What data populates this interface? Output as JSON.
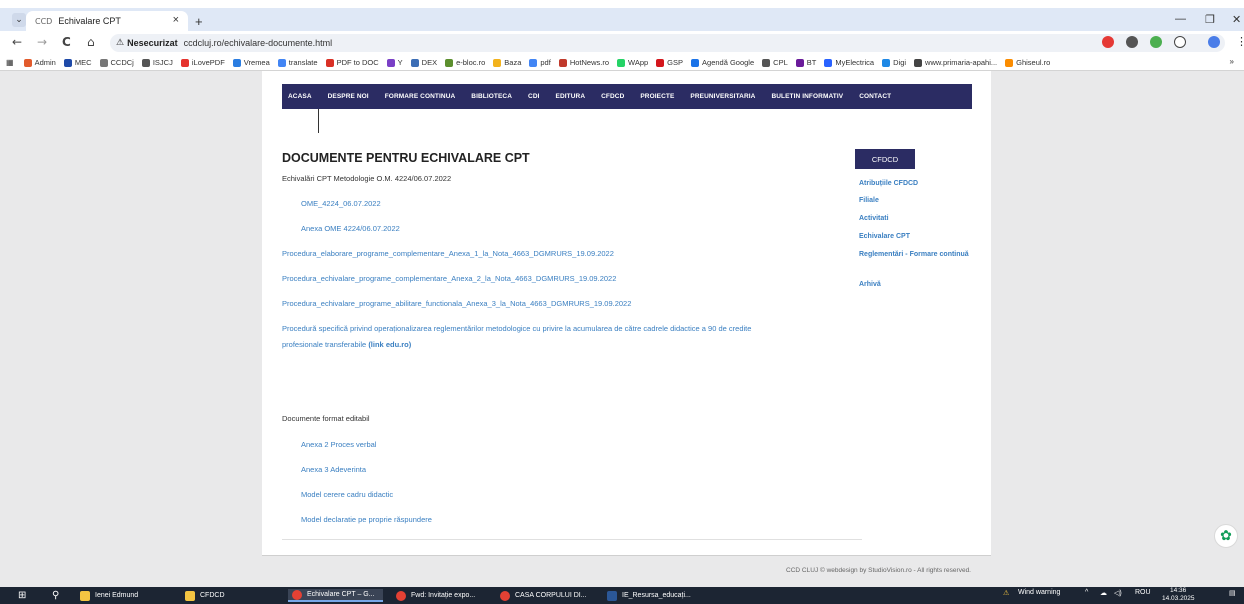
{
  "browser": {
    "tab_title": "Echivalare CPT",
    "tab_favicon": "CCD",
    "tab_list_glyph": "⌄",
    "tab_close": "×",
    "new_tab": "+",
    "win_min": "—",
    "win_max": "❐",
    "win_close": "✕",
    "back": "←",
    "forward": "→",
    "reload": "C",
    "home": "⌂",
    "security_icon": "⚠",
    "security_label": "Nesecurizat",
    "url": "ccdcluj.ro/echivalare-documente.html",
    "star_glyph": "☆",
    "menu_glyph": "⋮"
  },
  "bookmarks": {
    "items": [
      {
        "label": "Admin",
        "color": "#e25b2c"
      },
      {
        "label": "MEC",
        "color": "#1f4aa8"
      },
      {
        "label": "CCDCj",
        "color": "#777777"
      },
      {
        "label": "ISJCJ",
        "color": "#555555"
      },
      {
        "label": "iLovePDF",
        "color": "#e5322d"
      },
      {
        "label": "Vremea",
        "color": "#2a7de1"
      },
      {
        "label": "translate",
        "color": "#4285f4"
      },
      {
        "label": "PDF to DOC",
        "color": "#d93025"
      },
      {
        "label": "Y",
        "color": "#7a3fc6"
      },
      {
        "label": "DEX",
        "color": "#3b6db5"
      },
      {
        "label": "e-bloc.ro",
        "color": "#5c8f2e"
      },
      {
        "label": "Baza",
        "color": "#f2b21c"
      },
      {
        "label": "pdf",
        "color": "#4285f4"
      },
      {
        "label": "HotNews.ro",
        "color": "#c0392b"
      },
      {
        "label": "WApp",
        "color": "#25d366"
      },
      {
        "label": "GSP",
        "color": "#d4161c"
      },
      {
        "label": "Agendă Google",
        "color": "#1a73e8"
      },
      {
        "label": "CPL",
        "color": "#555555"
      },
      {
        "label": "BT",
        "color": "#6a1b9a"
      },
      {
        "label": "MyElectrica",
        "color": "#2962ff"
      },
      {
        "label": "Digi",
        "color": "#1e88e5"
      },
      {
        "label": "www.primaria-apahi...",
        "color": "#444444"
      },
      {
        "label": "Ghiseul.ro",
        "color": "#fb8c00"
      }
    ],
    "more": "»"
  },
  "nav": {
    "items": [
      "ACASA",
      "DESPRE NOI",
      "FORMARE CONTINUA",
      "BIBLIOTECA",
      "CDI",
      "EDITURA",
      "CFDCD",
      "PROIECTE",
      "PREUNIVERSITARIA",
      "BULETIN INFORMATIV",
      "CONTACT"
    ]
  },
  "content": {
    "title": "DOCUMENTE PENTRU ECHIVALARE CPT",
    "intro": "Echivalări CPT Metodologie O.M. 4224/06.07.2022",
    "links": [
      "OME_4224_06.07.2022",
      "Anexa OME 4224/06.07.2022",
      "Procedura_elaborare_programe_complementare_Anexa_1_la_Nota_4663_DGMRURS_19.09.2022",
      "Procedura_echivalare_programe_complementare_Anexa_2_la_Nota_4663_DGMRURS_19.09.2022",
      "Procedura_echivalare_programe_abilitare_functionala_Anexa_3_la_Nota_4663_DGMRURS_19.09.2022"
    ],
    "procedure_line1": "Procedură specifică privind operaționalizarea reglementărilor metodologice cu privire la acumularea de către cadrele didactice a 90 de credite",
    "procedure_line2": "profesionale transferabile",
    "procedure_bold": "(link edu.ro)",
    "editable_heading": "Documente format editabil",
    "editable_links": [
      "Anexa 2 Proces verbal",
      "Anexa 3 Adeverinta",
      "Model cerere cadru didactic",
      "Model declaratie pe proprie răspundere"
    ]
  },
  "sidebar": {
    "box_label": "CFDCD",
    "links": [
      "Atribuțiile CFDCD",
      "Filiale",
      "Activitati",
      "Echivalare CPT",
      "Reglementări - Formare continuă",
      "Arhivă"
    ]
  },
  "footer": {
    "text": "CCD CLUJ © webdesign by StudioVision.ro - All rights reserved."
  },
  "taskbar": {
    "start_glyph": "⊞",
    "search_glyph": "⚲",
    "items": [
      "Ienei Edmund",
      "CFDCD",
      "Echivalare CPT – G...",
      "Fwd: Invitație expo...",
      "CASA CORPULUI DI...",
      "IE_Resursa_educați..."
    ],
    "weather": "Wind warning",
    "lang": "ROU",
    "time": "14:36",
    "date": "14.03.2025"
  },
  "colors": {
    "nav_bg": "#2b2c63",
    "link": "#3a7fc1",
    "taskbar_bg": "#1c2533"
  }
}
